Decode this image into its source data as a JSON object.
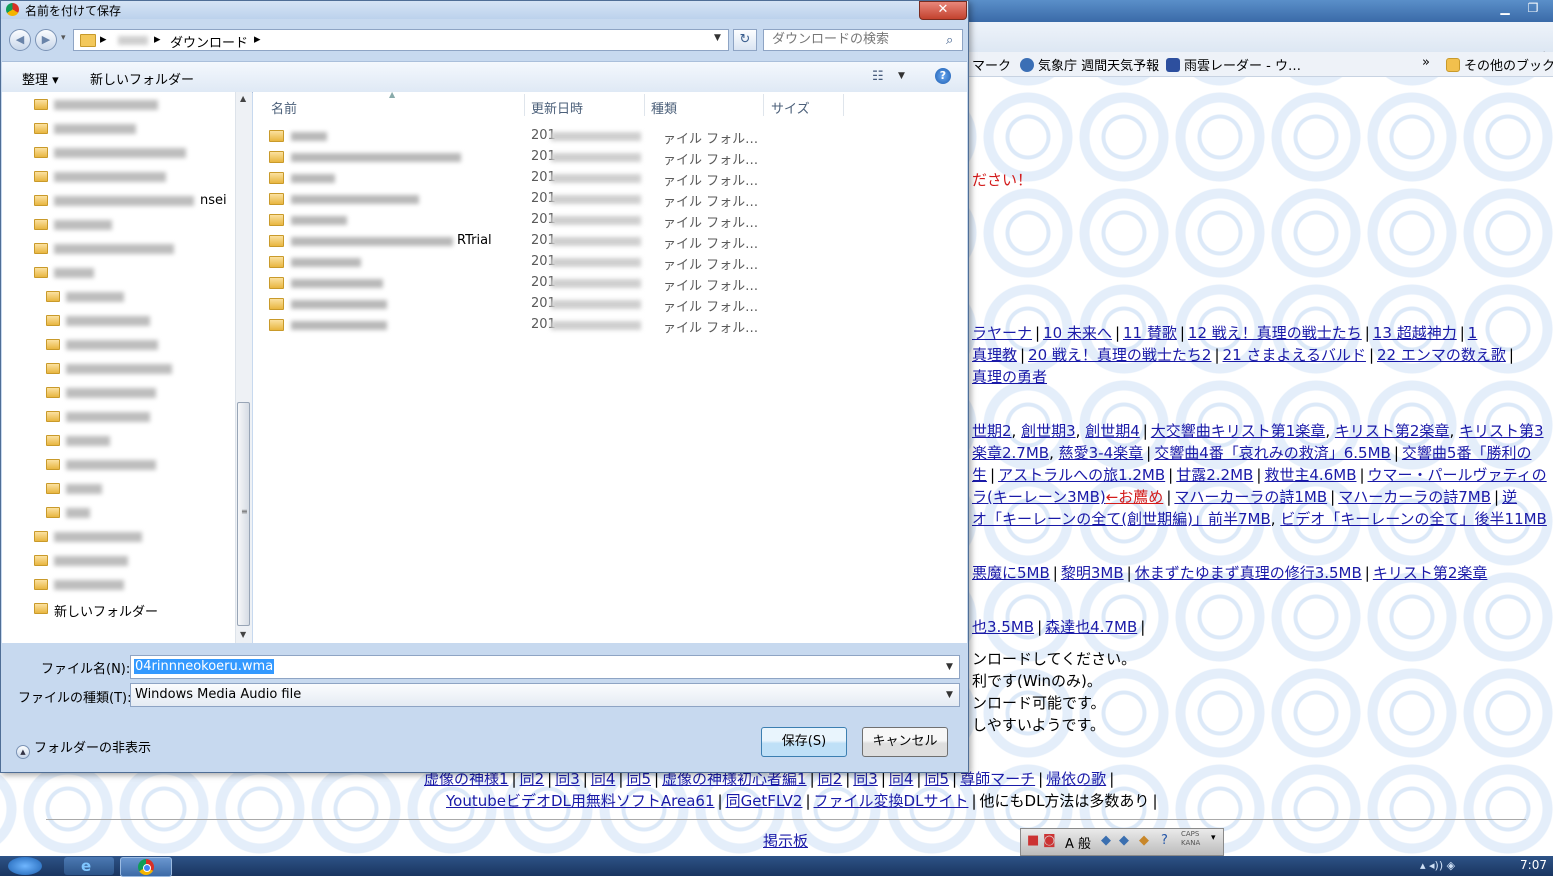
{
  "browser": {
    "bookmarks": [
      "マーク",
      "気象庁 週間天気予報",
      "雨雲レーダー - ウ…",
      "»",
      "その他のブック"
    ],
    "content": {
      "warning": "ださい！",
      "line1": [
        "ラヤーナ",
        "10 未来へ",
        "11 賛歌",
        "12 戦え！真理の戦士たち",
        "13 超越神力",
        "1"
      ],
      "line2": [
        "真理教",
        "20 戦え！真理の戦士たち2",
        "21 さまよえるバルド",
        "22 エンマの数え歌"
      ],
      "line3": [
        "真理の勇者"
      ],
      "line4a": [
        "世期2",
        "創世期3",
        "創世期4"
      ],
      "line4b": [
        "大交響曲キリスト第1楽章",
        "キリスト第2楽章",
        "キリスト第3"
      ],
      "line5": [
        "楽章2.7MB",
        "慈愛3-4楽章",
        "交響曲4番「哀れみの救済」6.5MB",
        "交響曲5番「勝利の"
      ],
      "line6": [
        "生",
        "アストラルへの旅1.2MB",
        "甘露2.2MB",
        "救世主4.6MB",
        "ウマー・パールヴァティの"
      ],
      "line7_start": "ラ(キーレーン3MB)",
      "line7_red": "←お薦め",
      "line7": [
        "マハーカーラの詩1MB",
        "マハーカーラの詩7MB",
        "逆"
      ],
      "line8": [
        "オ「キーレーンの全て(創世期編)」前半7MB",
        "ビデオ「キーレーンの全て」後半11MB"
      ],
      "line9": [
        "悪魔に5MB",
        "黎明3MB",
        "休まずたゆまず真理の修行3.5MB",
        "キリスト第2楽章"
      ],
      "line10": [
        "也3.5MB",
        "森達也4.7MB"
      ],
      "notes": [
        "ンロードしてください。",
        "利です(Winのみ)。",
        "ンロード可能です。",
        "しやすいようです。"
      ],
      "line11": [
        "虚像の神様1",
        "同2",
        "同3",
        "同4",
        "同5",
        "虚像の神様初心者編1",
        "同2",
        "同3",
        "同4",
        "同5",
        "尊師マーチ",
        "帰依の歌"
      ],
      "line12": [
        "YoutubeビデオDL用無料ソフトArea61",
        "同GetFLV2",
        "ファイル変換DLサイト"
      ],
      "line12_tail": "他にもDL方法は多数あり",
      "board": "掲示板"
    }
  },
  "taskbar": {
    "clock": "7:07"
  },
  "langbar": {
    "mode": "A 般",
    "caps": "CAPS",
    "kana": "KANA"
  },
  "dialog": {
    "title": "名前を付けて保存",
    "close": "✕",
    "address": {
      "separator": "▸",
      "current": "ダウンロード"
    },
    "search_placeholder": "ダウンロードの検索",
    "toolbar": {
      "organize": "整理 ▾",
      "new_folder": "新しいフォルダー"
    },
    "tree": {
      "partial_label": "nsei",
      "new_folder": "新しいフォルダー"
    },
    "columns": {
      "name": "名前",
      "date": "更新日時",
      "type": "種類",
      "size": "サイズ"
    },
    "files": [
      {
        "date": "201",
        "type": "ァイル フォル…",
        "suffix": ""
      },
      {
        "date": "201",
        "type": "ァイル フォル…",
        "suffix": ""
      },
      {
        "date": "201",
        "type": "ァイル フォル…",
        "suffix": ""
      },
      {
        "date": "201",
        "type": "ァイル フォル…",
        "suffix": ""
      },
      {
        "date": "201",
        "type": "ァイル フォル…",
        "suffix": ""
      },
      {
        "date": "201",
        "type": "ァイル フォル…",
        "suffix": "RTrial"
      },
      {
        "date": "201",
        "type": "ァイル フォル…",
        "suffix": ""
      },
      {
        "date": "201",
        "type": "ァイル フォル…",
        "suffix": ""
      },
      {
        "date": "201",
        "type": "ァイル フォル…",
        "suffix": ""
      },
      {
        "date": "201",
        "type": "ァイル フォル…",
        "suffix": ""
      }
    ],
    "filename_label": "ファイル名(N):",
    "filename_value": "04rinnneokoeru.wma",
    "filetype_label": "ファイルの種類(T):",
    "filetype_value": "Windows Media Audio file",
    "hide_folders": "フォルダーの非表示",
    "save": "保存(S)",
    "cancel": "キャンセル"
  }
}
